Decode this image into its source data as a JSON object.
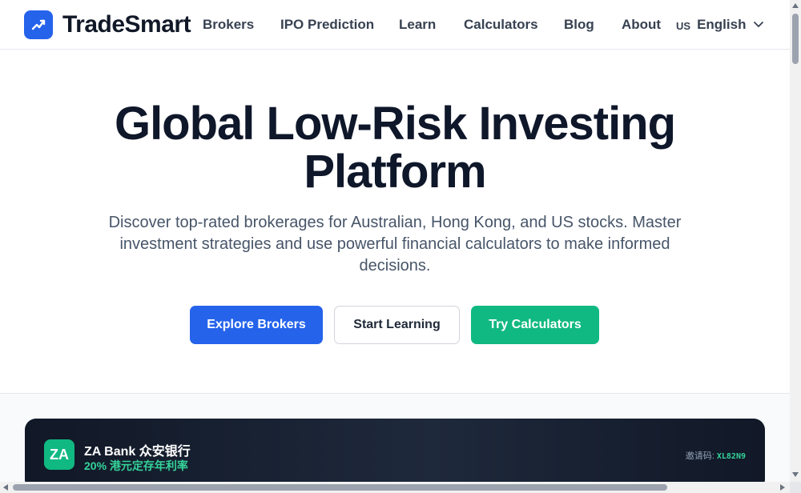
{
  "header": {
    "brand": "TradeSmart",
    "logo_icon": "chart-trend-icon",
    "nav": [
      {
        "label": "Brokers"
      },
      {
        "label": "IPO Prediction"
      },
      {
        "label": "Learn"
      },
      {
        "label": "Calculators"
      },
      {
        "label": "Blog"
      },
      {
        "label": "About"
      }
    ],
    "language": {
      "code": "US",
      "label": "English",
      "icon": "chevron-down-icon"
    }
  },
  "hero": {
    "title_line1": "Global Low-Risk Investing",
    "title_line2": "Platform",
    "subtitle": "Discover top-rated brokerages for Australian, Hong Kong, and US stocks. Master investment strategies and use powerful financial calculators to make informed decisions.",
    "buttons": {
      "primary": "Explore Brokers",
      "secondary": "Start Learning",
      "tertiary": "Try Calculators"
    }
  },
  "promo": {
    "badge": "ZA",
    "name": "ZA Bank 众安银行",
    "offer": "20% 港元定存年利率",
    "code_label": "邀请码:",
    "code": "XL82N9"
  },
  "colors": {
    "primary": "#2563eb",
    "success": "#10b981",
    "text": "#0f172a",
    "muted": "#475569"
  }
}
